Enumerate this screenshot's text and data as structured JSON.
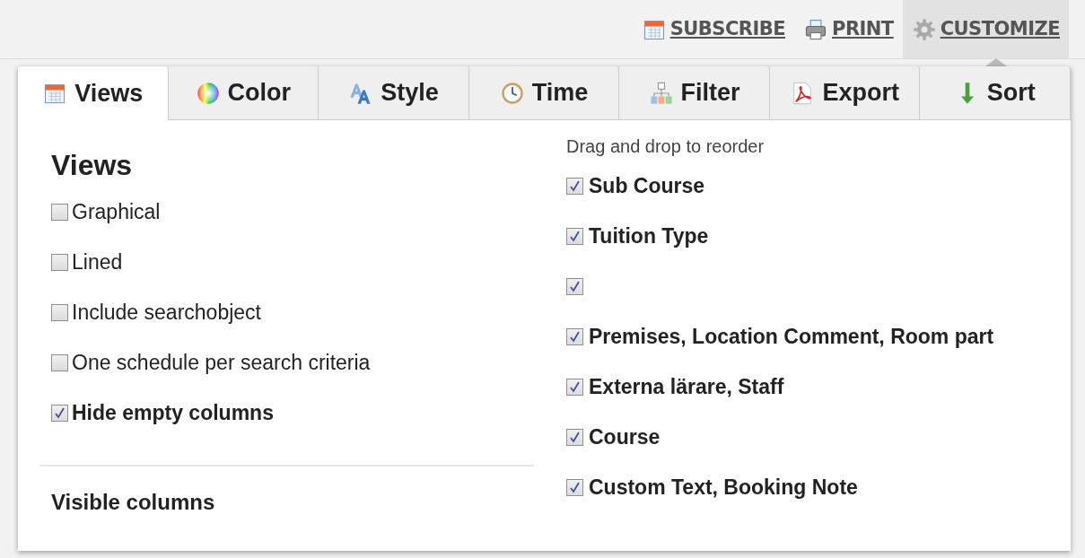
{
  "toolbar": [
    {
      "kind": "calendar",
      "label": "SUBSCRIBE",
      "selected": false
    },
    {
      "kind": "printer",
      "label": "PRINT",
      "selected": false
    },
    {
      "kind": "gear",
      "label": "CUSTOMIZE",
      "selected": true
    }
  ],
  "tabs": [
    {
      "kind": "calendar",
      "label": "Views",
      "selected": true
    },
    {
      "kind": "wheel",
      "label": "Color",
      "selected": false
    },
    {
      "kind": "letters",
      "label": "Style",
      "selected": false
    },
    {
      "kind": "clock",
      "label": "Time",
      "selected": false
    },
    {
      "kind": "tree",
      "label": "Filter",
      "selected": false
    },
    {
      "kind": "pdf",
      "label": "Export",
      "selected": false
    },
    {
      "kind": "down",
      "label": "Sort",
      "selected": false
    }
  ],
  "views": {
    "title": "Views",
    "options": [
      {
        "label": "Graphical",
        "checked": false
      },
      {
        "label": "Lined",
        "checked": false
      },
      {
        "label": "Include searchobject",
        "checked": false
      },
      {
        "label": "One schedule per search criteria",
        "checked": false
      },
      {
        "label": "Hide empty columns",
        "checked": true
      }
    ]
  },
  "visible_columns": {
    "title": "Visible columns"
  },
  "columns": {
    "hint": "Drag and drop to reorder",
    "items": [
      {
        "label": "Sub Course",
        "checked": true
      },
      {
        "label": "Tuition Type",
        "checked": true
      },
      {
        "checked": true
      },
      {
        "label": "Premises, Location Comment, Room part",
        "checked": true
      },
      {
        "label": "Externa lärare, Staff",
        "checked": true
      },
      {
        "label": "Course",
        "checked": true
      },
      {
        "label": "Custom Text, Booking Note",
        "checked": true
      }
    ]
  }
}
